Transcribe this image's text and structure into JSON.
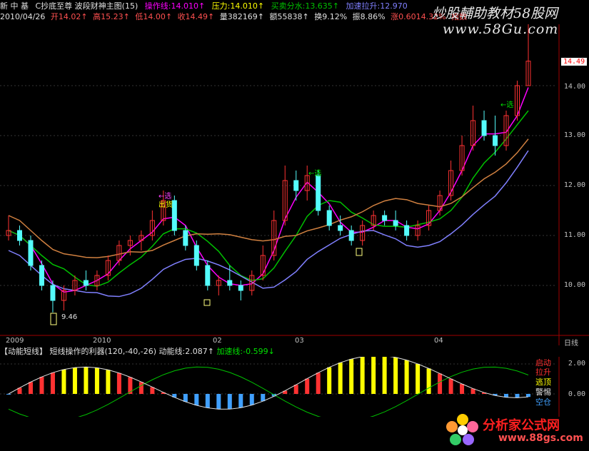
{
  "header": {
    "app_tag": "新 中 基",
    "formula_name": "C抄底至尊 波段财神主图(15)",
    "op_line": "操作线:14.010↑",
    "pressure": "压力:14.010↑",
    "support": "买卖分水:13.635↑",
    "accel": "加速拉升:12.970",
    "date": "2010/04/26",
    "open": "开14.02↑",
    "high": "高15.23↑",
    "low": "低14.00↑",
    "close": "收14.49↑",
    "volume": "量382169↑",
    "amount": "额55838↑",
    "turnover": "换9.12%",
    "amplitude": "振8.86%",
    "change": "涨0.6014.32%",
    "index_tag": "指数"
  },
  "watermark": {
    "line1": "炒股輔助教材58股网",
    "line2": "www.58Gu.com"
  },
  "axis": {
    "price_ticks": [
      "14.00",
      "13.00",
      "12.00",
      "11.00",
      "10.00"
    ],
    "current_price": "14.49",
    "date_ticks": [
      "2009",
      "2010",
      "02",
      "03",
      "04"
    ],
    "period": "日线"
  },
  "annotations": {
    "low_label": "9.46",
    "select1": "←选",
    "sell1": "出货",
    "select2": "←选",
    "select3": "←选"
  },
  "indicator": {
    "name": "【动能短线】",
    "desc": "短线操作的利器(120,-40,-26)",
    "momentum": "动能线:2.087↑",
    "accel": "加速线:-0.599↓",
    "ticks": [
      "2.00",
      "0.00"
    ],
    "legend": [
      "启动",
      "拉升",
      "逃顶",
      "警惕",
      "空仓"
    ]
  },
  "logo": {
    "name": "分析家公式网",
    "url": "www.88gs.com"
  },
  "colors": {
    "up": "#ff3232",
    "down": "#54fcfc",
    "white": "#e0e0e0",
    "yellow": "#ffff00",
    "magenta": "#ff00ff",
    "green": "#00c000",
    "orange": "#ffa500"
  },
  "chart_data": {
    "type": "candlestick",
    "price_range": [
      9.2,
      15.3
    ],
    "candles": [
      {
        "o": 11.0,
        "h": 11.4,
        "l": 10.9,
        "c": 11.1
      },
      {
        "o": 11.1,
        "h": 11.2,
        "l": 10.8,
        "c": 10.9
      },
      {
        "o": 10.9,
        "h": 11.0,
        "l": 10.3,
        "c": 10.4
      },
      {
        "o": 10.4,
        "h": 10.5,
        "l": 9.9,
        "c": 10.0
      },
      {
        "o": 10.0,
        "h": 10.1,
        "l": 9.46,
        "c": 9.7
      },
      {
        "o": 9.7,
        "h": 10.0,
        "l": 9.5,
        "c": 9.9
      },
      {
        "o": 9.9,
        "h": 10.2,
        "l": 9.8,
        "c": 10.1
      },
      {
        "o": 10.1,
        "h": 10.3,
        "l": 9.9,
        "c": 10.0
      },
      {
        "o": 10.0,
        "h": 10.3,
        "l": 9.9,
        "c": 10.2
      },
      {
        "o": 10.2,
        "h": 10.6,
        "l": 10.1,
        "c": 10.5
      },
      {
        "o": 10.5,
        "h": 10.9,
        "l": 10.4,
        "c": 10.8
      },
      {
        "o": 10.8,
        "h": 11.0,
        "l": 10.6,
        "c": 10.9
      },
      {
        "o": 10.9,
        "h": 11.1,
        "l": 10.7,
        "c": 11.0
      },
      {
        "o": 11.0,
        "h": 11.5,
        "l": 10.9,
        "c": 11.3
      },
      {
        "o": 11.3,
        "h": 11.9,
        "l": 11.2,
        "c": 11.7
      },
      {
        "o": 11.7,
        "h": 11.8,
        "l": 11.0,
        "c": 11.1
      },
      {
        "o": 11.1,
        "h": 11.2,
        "l": 10.7,
        "c": 10.8
      },
      {
        "o": 10.8,
        "h": 10.9,
        "l": 10.3,
        "c": 10.4
      },
      {
        "o": 10.4,
        "h": 10.5,
        "l": 9.9,
        "c": 10.0
      },
      {
        "o": 10.0,
        "h": 10.2,
        "l": 9.8,
        "c": 10.1
      },
      {
        "o": 10.1,
        "h": 10.4,
        "l": 9.9,
        "c": 10.0
      },
      {
        "o": 10.0,
        "h": 10.1,
        "l": 9.7,
        "c": 9.9
      },
      {
        "o": 9.9,
        "h": 10.3,
        "l": 9.8,
        "c": 10.2
      },
      {
        "o": 10.2,
        "h": 10.8,
        "l": 10.1,
        "c": 10.6
      },
      {
        "o": 10.6,
        "h": 11.5,
        "l": 10.5,
        "c": 11.3
      },
      {
        "o": 11.3,
        "h": 12.4,
        "l": 11.2,
        "c": 12.1
      },
      {
        "o": 12.1,
        "h": 12.3,
        "l": 11.7,
        "c": 11.9
      },
      {
        "o": 11.9,
        "h": 12.4,
        "l": 11.7,
        "c": 12.2
      },
      {
        "o": 12.2,
        "h": 12.3,
        "l": 11.4,
        "c": 11.5
      },
      {
        "o": 11.5,
        "h": 11.6,
        "l": 11.1,
        "c": 11.2
      },
      {
        "o": 11.2,
        "h": 11.4,
        "l": 11.0,
        "c": 11.1
      },
      {
        "o": 11.1,
        "h": 11.2,
        "l": 10.8,
        "c": 10.9
      },
      {
        "o": 10.9,
        "h": 11.3,
        "l": 10.8,
        "c": 11.2
      },
      {
        "o": 11.2,
        "h": 11.5,
        "l": 11.1,
        "c": 11.4
      },
      {
        "o": 11.4,
        "h": 11.5,
        "l": 11.2,
        "c": 11.3
      },
      {
        "o": 11.3,
        "h": 11.5,
        "l": 11.1,
        "c": 11.2
      },
      {
        "o": 11.2,
        "h": 11.3,
        "l": 10.9,
        "c": 11.0
      },
      {
        "o": 11.0,
        "h": 11.3,
        "l": 10.9,
        "c": 11.2
      },
      {
        "o": 11.2,
        "h": 11.6,
        "l": 11.1,
        "c": 11.5
      },
      {
        "o": 11.5,
        "h": 11.9,
        "l": 11.4,
        "c": 11.8
      },
      {
        "o": 11.8,
        "h": 12.5,
        "l": 11.7,
        "c": 12.3
      },
      {
        "o": 12.3,
        "h": 13.0,
        "l": 12.2,
        "c": 12.8
      },
      {
        "o": 12.8,
        "h": 13.6,
        "l": 12.7,
        "c": 13.3
      },
      {
        "o": 13.3,
        "h": 13.5,
        "l": 12.9,
        "c": 13.0
      },
      {
        "o": 13.0,
        "h": 13.4,
        "l": 12.6,
        "c": 12.8
      },
      {
        "o": 12.8,
        "h": 13.5,
        "l": 12.7,
        "c": 13.4
      },
      {
        "o": 13.4,
        "h": 14.1,
        "l": 13.3,
        "c": 14.0
      },
      {
        "o": 14.0,
        "h": 15.23,
        "l": 14.0,
        "c": 14.49
      }
    ]
  }
}
